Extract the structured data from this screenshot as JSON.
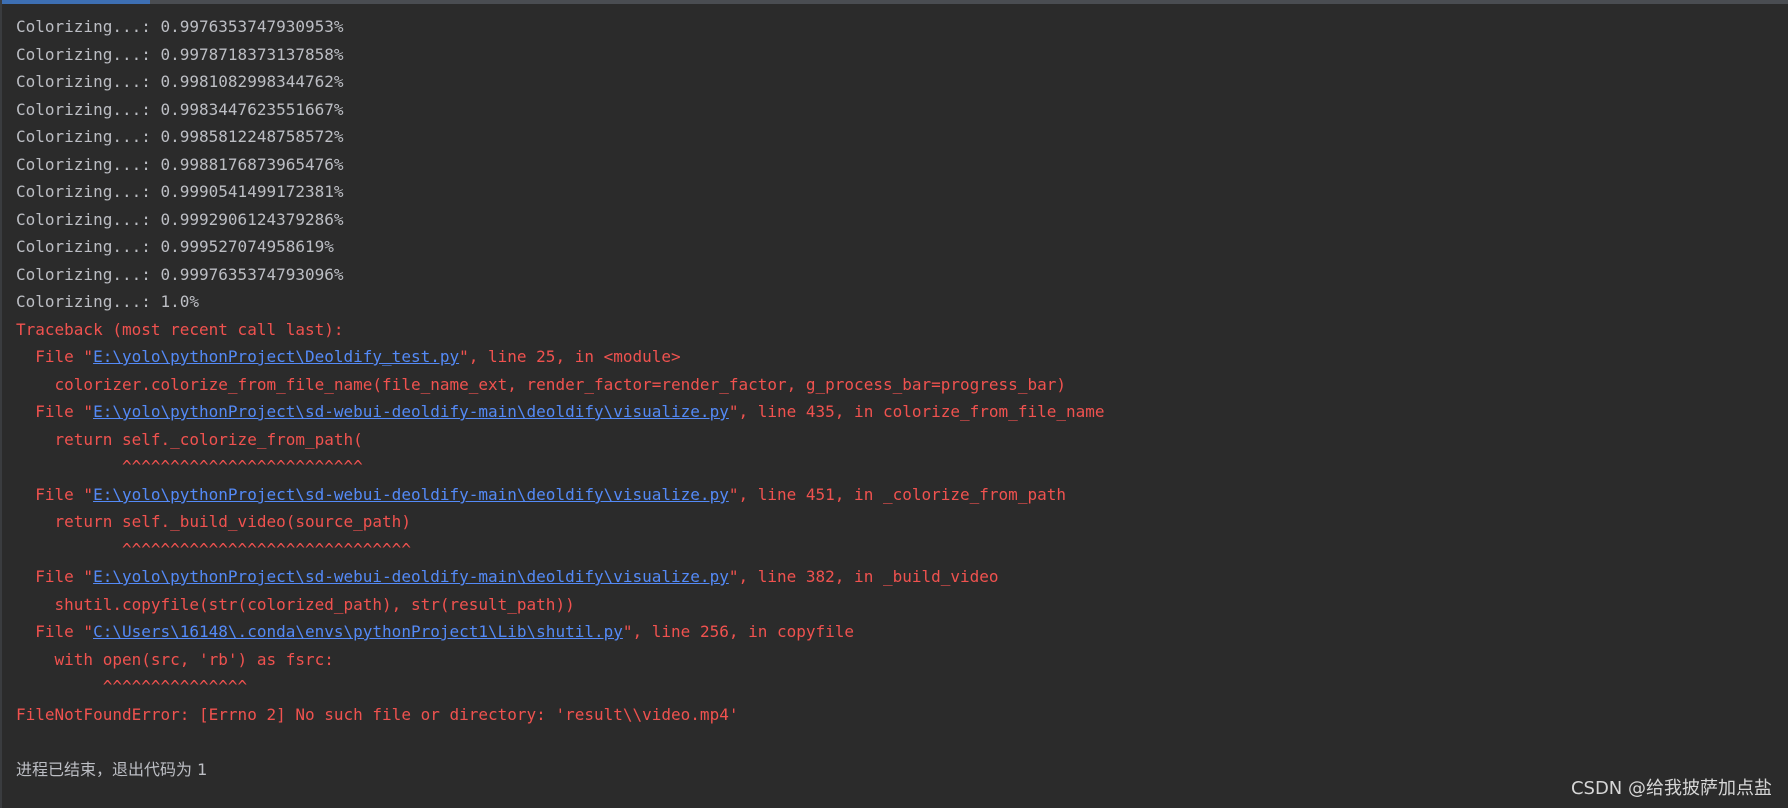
{
  "console": {
    "progress_lines": [
      "Colorizing...: 0.9976353747930953%",
      "Colorizing...: 0.9978718373137858%",
      "Colorizing...: 0.9981082998344762%",
      "Colorizing...: 0.9983447623551667%",
      "Colorizing...: 0.9985812248758572%",
      "Colorizing...: 0.9988176873965476%",
      "Colorizing...: 0.9990541499172381%",
      "Colorizing...: 0.9992906124379286%",
      "Colorizing...: 0.999527074958619%",
      "Colorizing...: 0.9997635374793096%",
      "Colorizing...: 1.0%"
    ],
    "traceback": {
      "header": "Traceback (most recent call last):",
      "frames": [
        {
          "prefix": "  File \"",
          "path": "E:\\yolo\\pythonProject\\Deoldify_test.py",
          "suffix": "\", line 25, in <module>",
          "code": "    colorizer.colorize_from_file_name(file_name_ext, render_factor=render_factor, g_process_bar=progress_bar)"
        },
        {
          "prefix": "  File \"",
          "path": "E:\\yolo\\pythonProject\\sd-webui-deoldify-main\\deoldify\\visualize.py",
          "suffix": "\", line 435, in colorize_from_file_name",
          "code": "    return self._colorize_from_path(",
          "marker": "           ^^^^^^^^^^^^^^^^^^^^^^^^^"
        },
        {
          "prefix": "  File \"",
          "path": "E:\\yolo\\pythonProject\\sd-webui-deoldify-main\\deoldify\\visualize.py",
          "suffix": "\", line 451, in _colorize_from_path",
          "code": "    return self._build_video(source_path)",
          "marker": "           ^^^^^^^^^^^^^^^^^^^^^^^^^^^^^^"
        },
        {
          "prefix": "  File \"",
          "path": "E:\\yolo\\pythonProject\\sd-webui-deoldify-main\\deoldify\\visualize.py",
          "suffix": "\", line 382, in _build_video",
          "code": "    shutil.copyfile(str(colorized_path), str(result_path))"
        },
        {
          "prefix": "  File \"",
          "path": "C:\\Users\\16148\\.conda\\envs\\pythonProject1\\Lib\\shutil.py",
          "suffix": "\", line 256, in copyfile",
          "code": "    with open(src, 'rb') as fsrc:",
          "marker": "         ^^^^^^^^^^^^^^^"
        }
      ],
      "error": "FileNotFoundError: [Errno 2] No such file or directory: 'result\\\\video.mp4'"
    },
    "exit_message": "进程已结束，退出代码为 1"
  },
  "watermark": "CSDN @给我披萨加点盐",
  "colors": {
    "background": "#2b2b2b",
    "normal_text": "#bcbec4",
    "error_text": "#f0524f",
    "link_text": "#548af7"
  }
}
